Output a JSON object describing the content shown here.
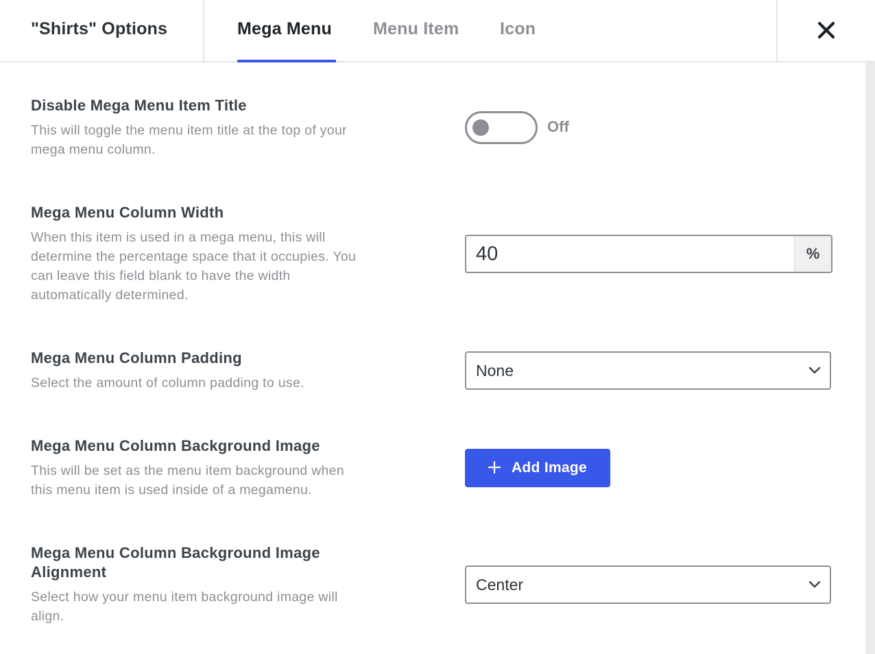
{
  "header": {
    "title": "\"Shirts\" Options",
    "tabs": [
      {
        "label": "Mega Menu",
        "active": true
      },
      {
        "label": "Menu Item",
        "active": false
      },
      {
        "label": "Icon",
        "active": false
      }
    ],
    "close_icon": "close-icon"
  },
  "settings": {
    "disable_title": {
      "label": "Disable Mega Menu Item Title",
      "desc_lines": [
        "This will toggle the menu item title at the top of your",
        "mega menu column."
      ],
      "toggle_state": "Off"
    },
    "column_width": {
      "label": "Mega Menu Column Width",
      "desc_lines": [
        "When this item is used in a mega menu, this will",
        "determine the percentage space that it occupies. You",
        "can leave this field blank to have the width",
        "automatically determined."
      ],
      "value": "40",
      "unit": "%"
    },
    "column_padding": {
      "label": "Mega Menu Column Padding",
      "desc_lines": [
        "Select the amount of column padding to use."
      ],
      "selected": "None"
    },
    "bg_image": {
      "label": "Mega Menu Column Background Image",
      "desc_lines": [
        "This will be set as the menu item background when",
        "this menu item is used inside of a megamenu."
      ],
      "button_label": "Add Image",
      "button_icon": "plus-icon"
    },
    "bg_alignment": {
      "label_lines": [
        "Mega Menu Column Background Image",
        "Alignment"
      ],
      "desc_lines": [
        "Select how your menu item background image will",
        "align."
      ],
      "selected": "Center"
    }
  },
  "colors": {
    "accent": "#3858e9",
    "text_dark": "#1d2327",
    "text_muted": "#8c8f94"
  }
}
